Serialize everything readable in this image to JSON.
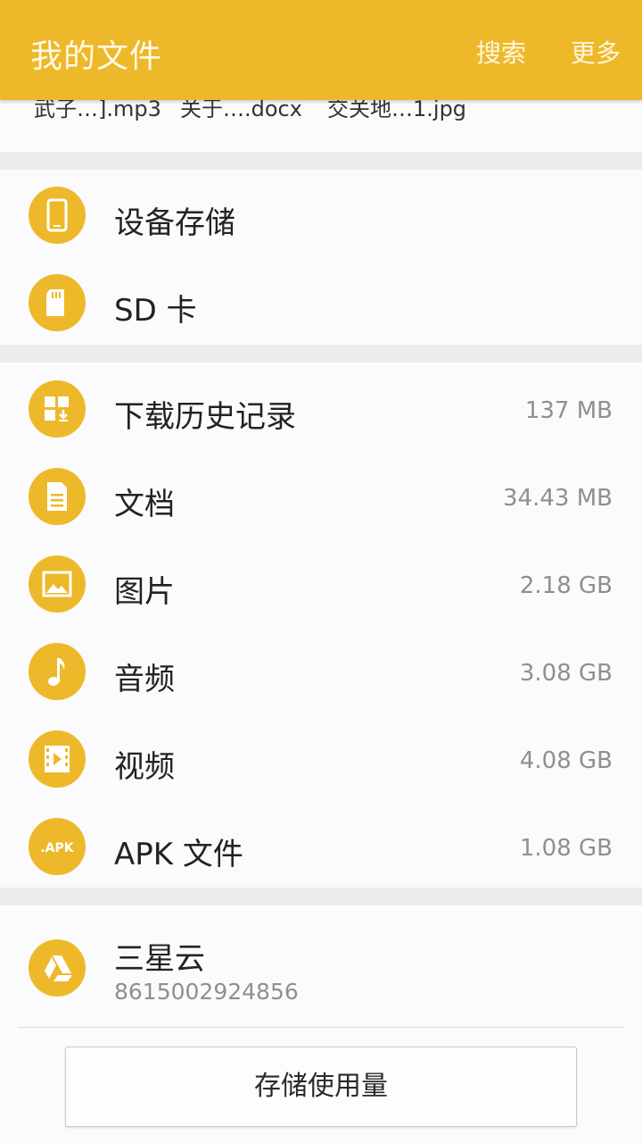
{
  "appbar": {
    "title": "我的文件",
    "search_label": "搜索",
    "more_label": "更多",
    "accent_color": "#edb92a"
  },
  "recent_files": [
    {
      "name": "武子…].mp3"
    },
    {
      "name": "关于….docx"
    },
    {
      "name": "交关地…1.jpg"
    }
  ],
  "storage": {
    "items": [
      {
        "label": "设备存储",
        "icon": "phone-icon"
      },
      {
        "label": "SD 卡",
        "icon": "sd-card-icon"
      }
    ]
  },
  "categories": {
    "items": [
      {
        "label": "下载历史记录",
        "size": "137 MB",
        "icon": "download-history-icon"
      },
      {
        "label": "文档",
        "size": "34.43 MB",
        "icon": "document-icon"
      },
      {
        "label": "图片",
        "size": "2.18 GB",
        "icon": "image-icon"
      },
      {
        "label": "音频",
        "size": "3.08 GB",
        "icon": "music-note-icon"
      },
      {
        "label": "视频",
        "size": "4.08 GB",
        "icon": "video-icon"
      },
      {
        "label": "APK 文件",
        "size": "1.08 GB",
        "icon": "apk-icon"
      }
    ]
  },
  "cloud": {
    "label": "三星云",
    "account": "8615002924856",
    "icon": "cloud-drive-icon"
  },
  "storage_usage_button": "存储使用量"
}
